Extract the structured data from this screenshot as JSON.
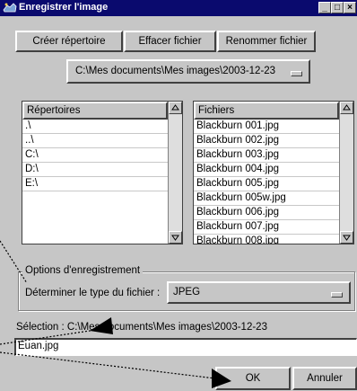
{
  "window": {
    "title": "Enregistrer l'image",
    "controls": {
      "minimize": "_",
      "maximize": "□",
      "close": "×"
    }
  },
  "toolbar": {
    "create_folder": "Créer répertoire",
    "delete_file": "Effacer fichier",
    "rename_file": "Renommer fichier"
  },
  "path_combo": {
    "value": "C:\\Mes documents\\Mes images\\2003-12-23"
  },
  "directories": {
    "header": "Répertoires",
    "items": [
      ".\\",
      "..\\",
      "C:\\",
      "D:\\",
      "E:\\"
    ]
  },
  "files": {
    "header": "Fichiers",
    "items": [
      "Blackburn 001.jpg",
      "Blackburn 002.jpg",
      "Blackburn 003.jpg",
      "Blackburn 004.jpg",
      "Blackburn 005.jpg",
      "Blackburn 005w.jpg",
      "Blackburn 006.jpg",
      "Blackburn 007.jpg",
      "Blackburn 008.jpg"
    ]
  },
  "options": {
    "group_label": "Options d'enregistrement",
    "type_label": "Déterminer le type du fichier :",
    "type_value": "JPEG"
  },
  "selection": {
    "label": "Sélection : C:\\Mes documents\\Mes images\\2003-12-23",
    "filename": "Euan.jpg"
  },
  "buttons": {
    "ok": "OK",
    "cancel": "Annuler"
  },
  "icons": {
    "window_icon": "image-app-icon"
  },
  "colors": {
    "titlebar": "#0a0a6e",
    "face": "#c6c6c6",
    "arrow": "#000000"
  }
}
